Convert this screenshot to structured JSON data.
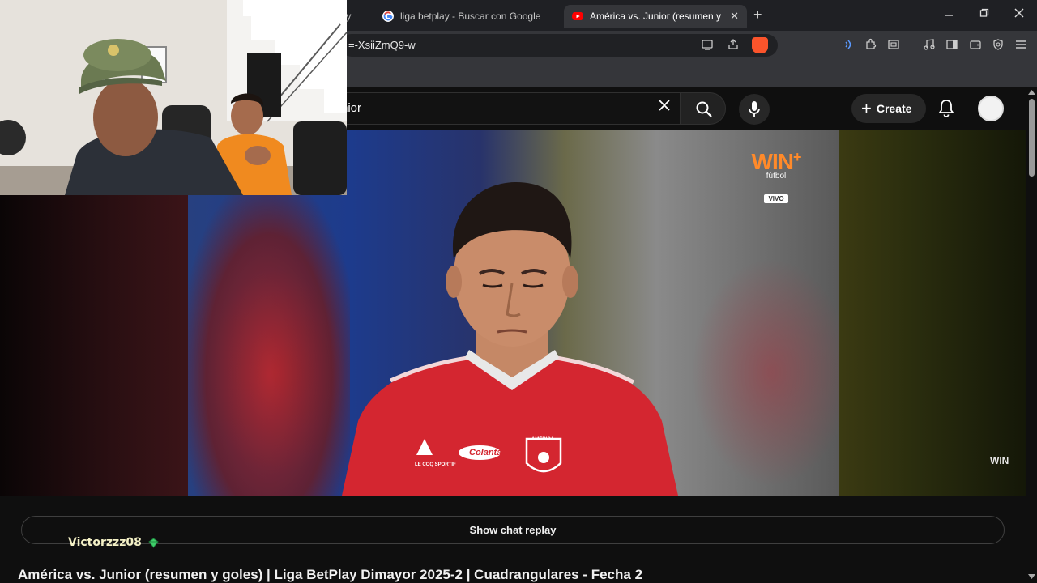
{
  "browser": {
    "tabs": [
      {
        "label": "boy",
        "active": false
      },
      {
        "label": "liga betplay - Buscar con Google",
        "active": false,
        "favicon": "google-icon"
      },
      {
        "label": "América vs. Junior (resumen y go",
        "active": true,
        "favicon": "youtube-icon"
      }
    ],
    "url_fragment": "=-XsiiZmQ9-w",
    "new_tab_symbol": "+",
    "close_symbol": "✕"
  },
  "youtube": {
    "search_value": "nior",
    "create_label": "Create",
    "show_chat_replay_label": "Show chat replay",
    "video_title": "América vs. Junior (resumen y goles) | Liga BetPlay Dimayor 2025-2 | Cuadrangulares - Fecha 2"
  },
  "broadcast": {
    "logo_text": "WIN",
    "logo_plus": "+",
    "logo_sub": "fútbol",
    "live_badge": "VIVO",
    "corner_logo": "WIN",
    "jersey_sponsor": "Colanta",
    "jersey_badge": "AMÉRICA",
    "jersey_brand": "LE COQ SPORTIF"
  },
  "stream_overlay": {
    "username": "Victorzzz08"
  },
  "colors": {
    "youtube_red": "#ff0000",
    "brand_orange": "#ff8a2a",
    "jersey_red": "#d42630",
    "username_color": "#f4f1c6",
    "accent_green": "#3fcf6a"
  }
}
